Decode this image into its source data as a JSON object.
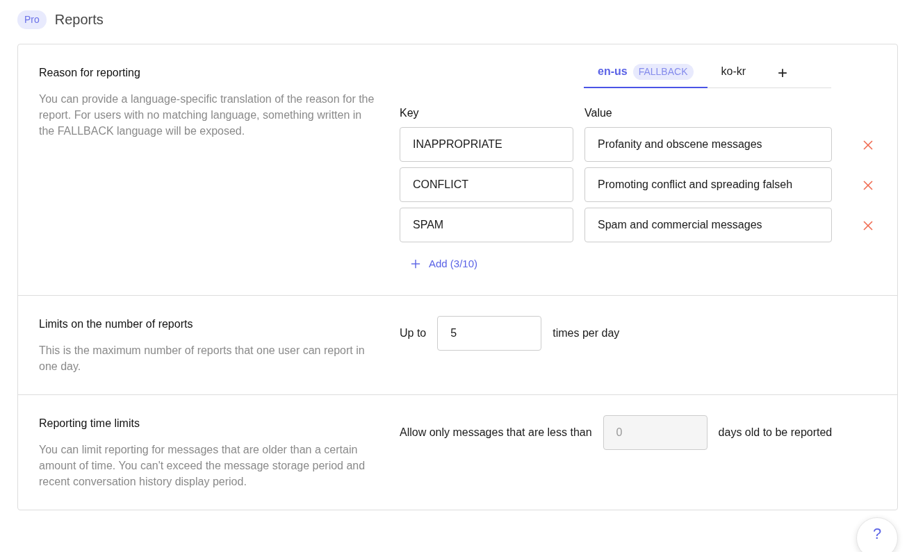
{
  "header": {
    "badge": "Pro",
    "title": "Reports"
  },
  "sections": [
    {
      "kind": "translations",
      "title": "Reason for reporting",
      "description": "You can provide a language-specific translation of the reason for the report. For users with no matching language, something written in the FALLBACK language will be exposed.",
      "tabs": [
        {
          "label": "en-us",
          "tag": "FALLBACK",
          "selected": true
        },
        {
          "label": "ko-kr",
          "selected": false
        }
      ],
      "add_tab": "+",
      "columns": [
        "Key",
        "Value"
      ],
      "rows": [
        {
          "key": "INAPPROPRIATE",
          "value": "Profanity and obscene messages"
        },
        {
          "key": "CONFLICT",
          "value": "Promoting conflict and spreading falseh"
        },
        {
          "key": "SPAM",
          "value": "Spam and commercial messages"
        }
      ],
      "add_button": "Add (3/10)"
    },
    {
      "kind": "inline",
      "title": "Limits on the number of reports",
      "description": "This is the maximum number of reports that one user can report in one day.",
      "prefix": "Up to",
      "value": "5",
      "disabled": false,
      "suffix": "times per day"
    },
    {
      "kind": "inline",
      "title": "Reporting time limits",
      "description": "You can limit reporting for messages that are older than a certain amount of time. You can't exceed the message storage period and recent conversation history display period.",
      "prefix": "Allow only messages that are less than",
      "value": "0",
      "disabled": true,
      "suffix": "days old to be reported"
    }
  ],
  "help_button": "?"
}
